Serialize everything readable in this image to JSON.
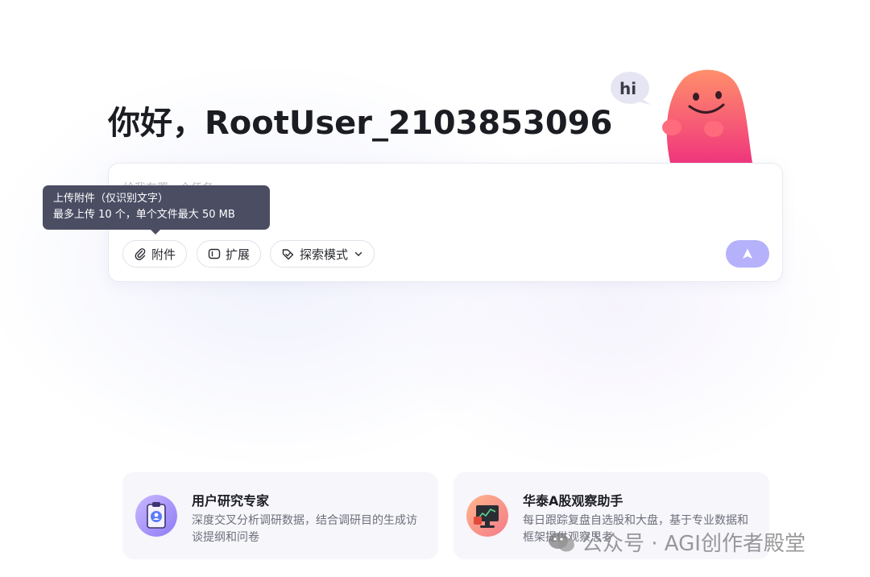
{
  "greeting": "你好，RootUser_2103853096",
  "mascot": {
    "bubble_text": "hi",
    "colors": {
      "body_top": "#ff8f6b",
      "body_bottom": "#f0367c"
    }
  },
  "input": {
    "placeholder": "给我布置一个任务",
    "tools": {
      "attach_label": "附件",
      "expand_label": "扩展",
      "mode_label": "探索模式"
    },
    "send_color": "#b5b2fb"
  },
  "tooltip": {
    "line1": "上传附件（仅识别文字）",
    "line2": "最多上传 10 个，单个文件最大 50 MB"
  },
  "agents": [
    {
      "title": "用户研究专家",
      "desc": "深度交叉分析调研数据，结合调研目的生成访谈提纲和问卷",
      "icon": "clipboard-user-icon"
    },
    {
      "title": "华泰A股观察助手",
      "desc": "每日跟踪复盘自选股和大盘，基于专业数据和框架提供观察思考",
      "icon": "stock-monitor-icon"
    }
  ],
  "watermark": "公众号 · AGI创作者殿堂"
}
